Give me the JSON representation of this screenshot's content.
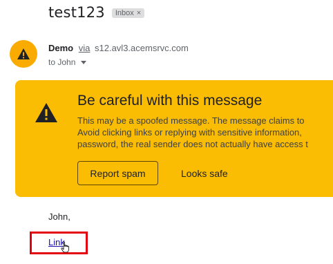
{
  "email": {
    "subject": "test123",
    "label_chip": "Inbox",
    "label_chip_close": "×",
    "sender_name": "Demo",
    "via_label": "via",
    "sender_domain": "s12.avl3.acemsrvc.com",
    "recipient_line": "to John"
  },
  "warning": {
    "title": "Be careful with this message",
    "lines": [
      "This may be a spoofed message. The message claims to",
      "Avoid clicking links or replying with sensitive information,",
      "password, the real sender does not actually have access t"
    ],
    "report_button": "Report spam",
    "safe_button": "Looks safe"
  },
  "body": {
    "greeting": "John,",
    "link_text": "Link"
  },
  "icons": {
    "avatar": "warning-icon",
    "banner": "warning-icon",
    "recipient_toggle": "caret-down-icon",
    "cursor": "hand-pointer-icon"
  },
  "colors": {
    "warning_background": "#fbbc04",
    "avatar_background": "#f9ab00",
    "highlight_box": "#e3000f",
    "link": "#1a0dab"
  }
}
